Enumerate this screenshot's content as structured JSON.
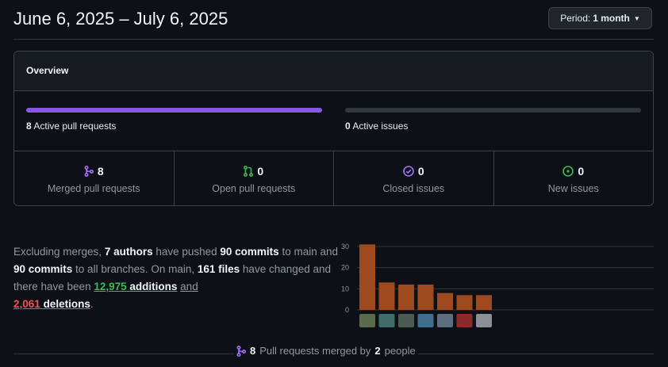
{
  "header": {
    "title": "June 6, 2025 – July 6, 2025",
    "period_label": "Period:",
    "period_value": "1 month"
  },
  "overview": {
    "title": "Overview",
    "pull_requests": {
      "count": "8",
      "label": "Active pull requests",
      "fill_fraction": 1.0,
      "color": "#8957e5"
    },
    "issues": {
      "count": "0",
      "label": "Active issues",
      "fill_fraction": 0.0,
      "color": "#238636"
    },
    "stats": [
      {
        "name": "merged",
        "value": "8",
        "label": "Merged pull requests",
        "icon": "git-merge-icon",
        "color": "#a371f7"
      },
      {
        "name": "open",
        "value": "0",
        "label": "Open pull requests",
        "icon": "git-pull-request-icon",
        "color": "#3fb950"
      },
      {
        "name": "closed",
        "value": "0",
        "label": "Closed issues",
        "icon": "issue-closed-icon",
        "color": "#a371f7"
      },
      {
        "name": "new",
        "value": "0",
        "label": "New issues",
        "icon": "issue-opened-icon",
        "color": "#3fb950"
      }
    ]
  },
  "summary": {
    "t1": "Excluding merges, ",
    "authors": "7 authors",
    "t2": " have pushed ",
    "commits_main": "90 commits",
    "t3": " to main and ",
    "commits_all": "90 commits",
    "t4": " to all branches. On main, ",
    "files": "161 files",
    "t5": " have changed and there have been ",
    "additions_num": "12,975",
    "additions_word": "additions",
    "t6": "and",
    "deletions_num": "2,061",
    "deletions_word": "deletions",
    "t7": "."
  },
  "chart_data": {
    "type": "bar",
    "categories": [
      "contributor-1",
      "contributor-2",
      "contributor-3",
      "contributor-4",
      "contributor-5",
      "contributor-6",
      "contributor-7"
    ],
    "values": [
      31,
      13,
      12,
      12,
      8,
      7,
      7
    ],
    "ylim": [
      0,
      33
    ],
    "yticks": [
      "0",
      "10",
      "20",
      "30"
    ],
    "grid": true,
    "bar_color": "#9e4a1e",
    "avatar_colors": [
      "#5a6b4e",
      "#3f6e6a",
      "#4c5a52",
      "#3d6f8e",
      "#5d6e7e",
      "#8a2b2b",
      "#8c8f94"
    ]
  },
  "footer": {
    "count": "8",
    "text1": "Pull requests merged by",
    "people": "2",
    "text2": "people"
  }
}
